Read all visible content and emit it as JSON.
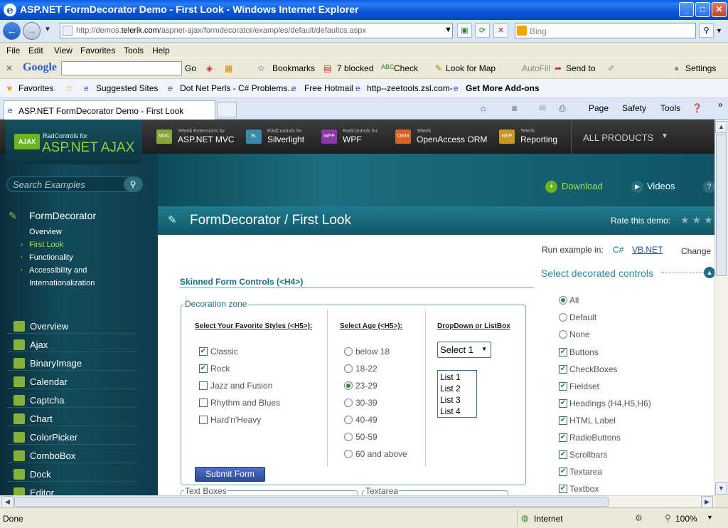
{
  "window": {
    "title": "ASP.NET FormDecorator Demo - First Look - Windows Internet Explorer",
    "min": "_",
    "max": "□",
    "close": "✕"
  },
  "address": {
    "url_pre": "http://demos.",
    "url_host": "telerik.com",
    "url_post": "/aspnet-ajax/formdecorator/examples/default/defaultcs.aspx",
    "search_placeholder": "Bing"
  },
  "menu": [
    "File",
    "Edit",
    "View",
    "Favorites",
    "Tools",
    "Help"
  ],
  "google": {
    "logo": "Google",
    "go": "Go",
    "bookmarks": "Bookmarks",
    "blocked": "7 blocked",
    "check": "Check",
    "lookformap": "Look for Map",
    "autofill": "AutoFill",
    "sendto": "Send to",
    "settings": "Settings"
  },
  "favbar": {
    "favorites": "Favorites",
    "suggested": "Suggested Sites",
    "dotnet": "Dot Net Perls - C# Problems...",
    "hotmail": "Free Hotmail",
    "zee": "http--zeetools.zsl.com-",
    "addons": "Get More Add-ons"
  },
  "tab": {
    "title": "ASP.NET FormDecorator Demo - First Look"
  },
  "commands": {
    "page": "Page",
    "safety": "Safety",
    "tools": "Tools"
  },
  "site": {
    "logo_small": "RadControls for",
    "logo_big": "ASP.NET AJAX",
    "logo_badge": "AJAX",
    "products": [
      {
        "small": "Telerik Extensions for",
        "name": "ASP.NET MVC",
        "badge": "MVC",
        "color": "#8aa63a"
      },
      {
        "small": "RadControls for",
        "name": "Silverlight",
        "badge": "SL",
        "color": "#3a8aa6"
      },
      {
        "small": "RadControls for",
        "name": "WPF",
        "badge": "WPF",
        "color": "#8a3aa6"
      },
      {
        "small": "Telerik",
        "name": "OpenAccess ORM",
        "badge": "ORM",
        "color": "#d4642a"
      },
      {
        "small": "Telerik",
        "name": "Reporting",
        "badge": "REP",
        "color": "#c9962a"
      }
    ],
    "all_products": "ALL PRODUCTS",
    "search_placeholder": "Search Examples",
    "download": "Download",
    "videos": "Videos",
    "help": "?",
    "section_title": "FormDecorator",
    "nav": [
      "Overview",
      "First Look",
      "Functionality",
      "Accessibility and",
      "Internationalization"
    ],
    "controls": [
      "Overview",
      "Ajax",
      "BinaryImage",
      "Calendar",
      "Captcha",
      "Chart",
      "ColorPicker",
      "ComboBox",
      "Dock",
      "Editor"
    ],
    "page_title": "FormDecorator / First Look",
    "rate": "Rate this demo:",
    "run_label": "Run example in:",
    "run_cs": "C#",
    "run_vb": "VB.NET",
    "change": "Change",
    "h4": "Skinned Form Controls (<H4>)",
    "zone": "Decoration zone",
    "styles_head": "Select Your Favorite Styles (<H5>):",
    "styles": [
      {
        "label": "Classic",
        "checked": true
      },
      {
        "label": "Rock",
        "checked": true
      },
      {
        "label": "Jazz and Fusion",
        "checked": false
      },
      {
        "label": "Rhythm and Blues",
        "checked": false
      },
      {
        "label": "Hard'n'Heavy",
        "checked": false
      }
    ],
    "age_head": "Select Age (<H5>):",
    "ages": [
      {
        "label": "below 18",
        "on": false
      },
      {
        "label": "18-22",
        "on": false
      },
      {
        "label": "23-29",
        "on": true
      },
      {
        "label": "30-39",
        "on": false
      },
      {
        "label": "40-49",
        "on": false
      },
      {
        "label": "50-59",
        "on": false
      },
      {
        "label": "60 and above",
        "on": false
      }
    ],
    "dd_head": "DropDown or ListBox",
    "dd_value": "Select 1",
    "listbox": [
      "List 1",
      "List 2",
      "List 3",
      "List 4"
    ],
    "submit": "Submit Form",
    "textboxes": "Text Boxes",
    "textarea": "Textarea",
    "select_title": "Select decorated controls",
    "filter_radios": [
      {
        "label": "All",
        "on": true
      },
      {
        "label": "Default",
        "on": false
      },
      {
        "label": "None",
        "on": false
      }
    ],
    "filter_checks": [
      "Buttons",
      "CheckBoxes",
      "Fieldset",
      "Headings (H4,H5,H6)",
      "HTML Label",
      "RadioButtons",
      "Scrollbars",
      "Textarea",
      "Textbox"
    ]
  },
  "status": {
    "done": "Done",
    "zone": "Internet",
    "zoom": "100%"
  }
}
